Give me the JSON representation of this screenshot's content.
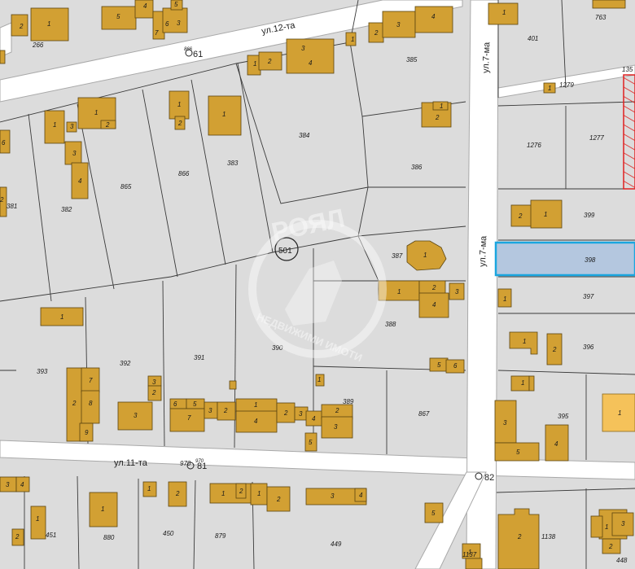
{
  "streets": {
    "north": "ул.12-та",
    "south": "ул.11-та",
    "east_upper": "ул.7-ма",
    "east_lower": "ул.7-ма"
  },
  "points": [
    {
      "label": "61",
      "pin": "point-61"
    },
    {
      "label": "81",
      "pin": "point-81"
    },
    {
      "label": "82",
      "pin": "point-82"
    }
  ],
  "highlighted_plot": "398",
  "plots": [
    "266",
    "763",
    "401",
    "385",
    "1279",
    "135",
    "384",
    "383",
    "866",
    "865",
    "382",
    "381",
    "386",
    "1276",
    "1277",
    "399",
    "387",
    "501",
    "398",
    "397",
    "388",
    "393",
    "392",
    "391",
    "390",
    "396",
    "389",
    "867",
    "395",
    "970",
    "451",
    "880",
    "450",
    "879",
    "449",
    "1138",
    "448",
    "1137"
  ],
  "labels_misc": {
    "point_prefix_61": "866",
    "point_prefix_81": "970"
  },
  "watermark": {
    "brand": "РОЯЛ",
    "subtitle": "НЕДВИЖИМИ ИМОТИ"
  },
  "colors": {
    "building": "#d2a033",
    "building_stroke": "#5a4410",
    "highlight_fill": "#b4c7df",
    "highlight_stroke": "#1aa6df",
    "pale_building": "#f5c25a",
    "hatch": "#e02020",
    "road": "#ffffff",
    "ground": "#dcdcdc"
  }
}
